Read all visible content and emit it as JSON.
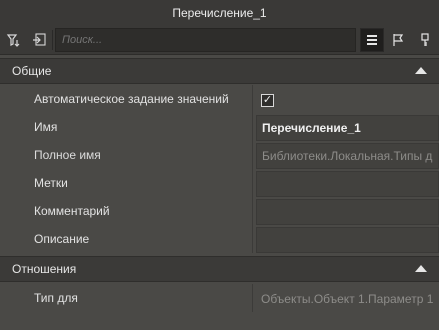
{
  "window": {
    "title": "Перечисление_1"
  },
  "toolbar": {
    "search_placeholder": "Поиск...",
    "left_buttons": [
      "filter-icon",
      "pin-icon"
    ],
    "right_buttons": [
      "list-icon",
      "flag-icon",
      "key-icon"
    ]
  },
  "sections": [
    {
      "label": "Общие",
      "rows": [
        {
          "name": "Автоматическое задание значений",
          "value": "✓",
          "type": "checkbox"
        },
        {
          "name": "Имя",
          "value": "Перечисление_1",
          "type": "text-bold"
        },
        {
          "name": "Полное имя",
          "value": "Библиотеки.Локальная.Типы д",
          "type": "text-grey"
        },
        {
          "name": "Метки",
          "value": "",
          "type": "text"
        },
        {
          "name": "Комментарий",
          "value": "",
          "type": "text"
        },
        {
          "name": "Описание",
          "value": "",
          "type": "text"
        }
      ]
    },
    {
      "label": "Отношения",
      "rows": [
        {
          "name": "Тип для",
          "value": "Объекты.Объект 1.Параметр 1",
          "type": "text-grey"
        }
      ]
    }
  ]
}
